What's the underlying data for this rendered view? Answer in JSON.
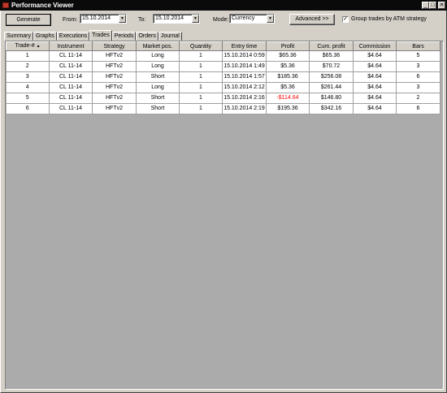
{
  "window": {
    "title": "Performance Viewer",
    "min_glyph": "_",
    "max_glyph": "□",
    "close_glyph": "✕"
  },
  "toolbar": {
    "generate_label": "Generate",
    "from_label": "From:",
    "from_value": "15.10.2014",
    "to_label": "To:",
    "to_value": "15.10.2014",
    "mode_label": "Mode:",
    "mode_value": "Currency",
    "advanced_label": "Advanced >>",
    "group_trades_label": "Group trades by ATM strategy",
    "group_trades_checked": true,
    "dropdown_glyph": "▼",
    "check_glyph": "✓"
  },
  "tabs": [
    {
      "label": "Summary",
      "active": false
    },
    {
      "label": "Graphs",
      "active": false
    },
    {
      "label": "Executions",
      "active": false
    },
    {
      "label": "Trades",
      "active": true
    },
    {
      "label": "Periods",
      "active": false
    },
    {
      "label": "Orders",
      "active": false
    },
    {
      "label": "Journal",
      "active": false
    }
  ],
  "table": {
    "sort_glyph": "▲",
    "columns": [
      "Trade-#",
      "Instrument",
      "Strategy",
      "Market pos.",
      "Quantity",
      "Entry time",
      "Profit",
      "Cum. profit",
      "Commission",
      "Bars"
    ],
    "rows": [
      [
        "1",
        "CL 11-14",
        "HFTv2",
        "Long",
        "1",
        "15.10.2014 0:59",
        "$65.36",
        "$65.36",
        "$4.64",
        "5"
      ],
      [
        "2",
        "CL 11-14",
        "HFTv2",
        "Long",
        "1",
        "15.10.2014 1:49",
        "$5.36",
        "$70.72",
        "$4.64",
        "3"
      ],
      [
        "3",
        "CL 11-14",
        "HFTv2",
        "Short",
        "1",
        "15.10.2014 1:57",
        "$185.36",
        "$256.08",
        "$4.64",
        "6"
      ],
      [
        "4",
        "CL 11-14",
        "HFTv2",
        "Long",
        "1",
        "15.10.2014 2:12",
        "$5.36",
        "$261.44",
        "$4.64",
        "3"
      ],
      [
        "5",
        "CL 11-14",
        "HFTv2",
        "Short",
        "1",
        "15.10.2014 2:16",
        "-$114.64",
        "$146.80",
        "$4.64",
        "2"
      ],
      [
        "6",
        "CL 11-14",
        "HFTv2",
        "Short",
        "1",
        "15.10.2014 2:19",
        "$195.36",
        "$342.16",
        "$4.64",
        "6"
      ]
    ],
    "negative_color": "#ff0000"
  }
}
